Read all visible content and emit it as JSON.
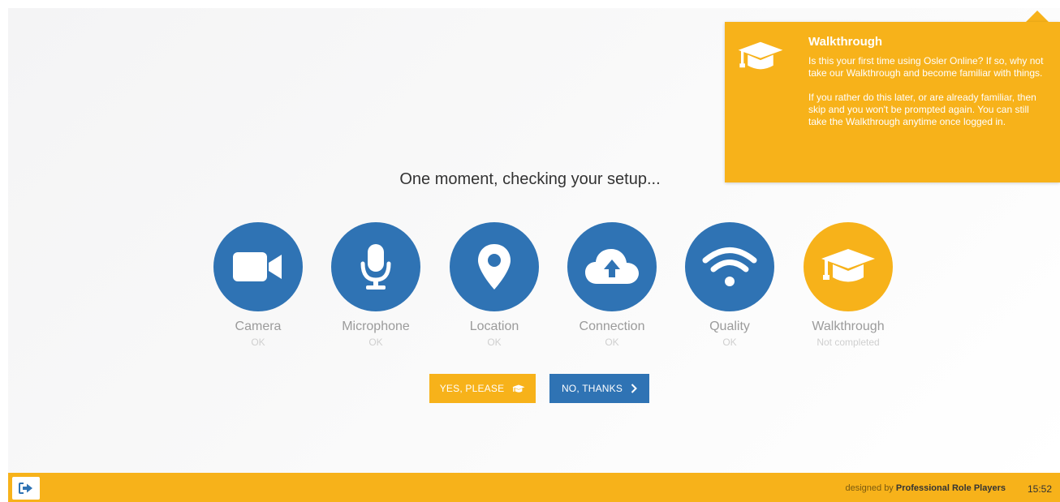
{
  "headline": "One moment, checking your setup...",
  "checks": [
    {
      "label": "Camera",
      "status": "OK",
      "icon": "video-camera-icon"
    },
    {
      "label": "Microphone",
      "status": "OK",
      "icon": "microphone-icon"
    },
    {
      "label": "Location",
      "status": "OK",
      "icon": "map-pin-icon"
    },
    {
      "label": "Connection",
      "status": "OK",
      "icon": "cloud-upload-icon"
    },
    {
      "label": "Quality",
      "status": "OK",
      "icon": "wifi-icon"
    },
    {
      "label": "Walkthrough",
      "status": "Not completed",
      "icon": "graduation-cap-icon"
    }
  ],
  "buttons": {
    "yes_label": "YES, PLEASE",
    "no_label": "NO, THANKS"
  },
  "tooltip": {
    "title": "Walkthrough",
    "paragraph1": "Is this your first time using Osler Online? If so, why not take our Walkthrough and become familiar with things.",
    "paragraph2": "If you rather do this later, or are already familiar, then skip and you won't be prompted again. You can still take the Walkthrough anytime once logged in."
  },
  "footer": {
    "credit_prefix": "designed by",
    "credit_name": "Professional Role Players",
    "time": "15:52"
  },
  "colors": {
    "accent": "#f7b21a",
    "ok": "#2f73b4"
  }
}
